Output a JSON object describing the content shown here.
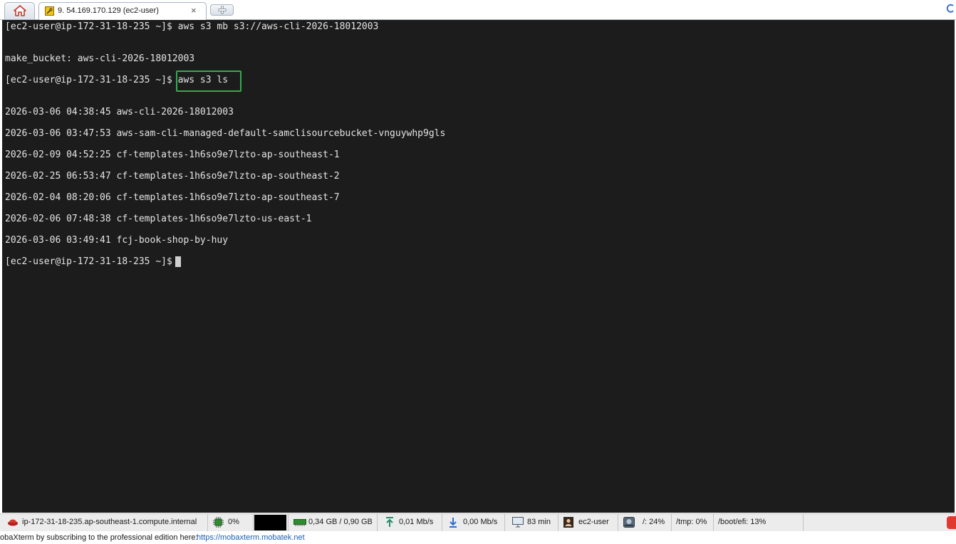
{
  "tabs": {
    "home_icon": "home-icon",
    "session_tab": {
      "label": "9. 54.169.170.129 (ec2-user)",
      "close": "×",
      "icon": "wrench-icon"
    },
    "new_tab_icon": "plus-icon"
  },
  "terminal": {
    "lines": [
      "[ec2-user@ip-172-31-18-235 ~]$ aws s3 mb s3://aws-cli-2026-18012003",
      "make_bucket: aws-cli-2026-18012003",
      "[ec2-user@ip-172-31-18-235 ~]$ aws s3 ls",
      "2026-03-06 04:38:45 aws-cli-2026-18012003",
      "2026-03-06 03:47:53 aws-sam-cli-managed-default-samclisourcebucket-vnguywhp9gls",
      "2026-02-09 04:52:25 cf-templates-1h6so9e7lzto-ap-southeast-1",
      "2026-02-25 06:53:47 cf-templates-1h6so9e7lzto-ap-southeast-2",
      "2026-02-04 08:20:06 cf-templates-1h6so9e7lzto-ap-southeast-7",
      "2026-02-06 07:48:38 cf-templates-1h6so9e7lzto-us-east-1",
      "2026-03-06 03:49:41 fcj-book-shop-by-huy",
      "[ec2-user@ip-172-31-18-235 ~]$"
    ],
    "highlighted_command": "aws s3 ls",
    "highlight_color": "#2fae4a",
    "background_color": "#1c1c1c",
    "text_color": "#e4e4e4"
  },
  "statusbar": {
    "host": "ip-172-31-18-235.ap-southeast-1.compute.internal",
    "cpu": "0%",
    "memory": "0,34 GB / 0,90 GB",
    "upload": "0,01 Mb/s",
    "download": "0,00 Mb/s",
    "uptime": "83 min",
    "user": "ec2-user",
    "disk_root": "/: 24%",
    "disk_tmp": "/tmp: 0%",
    "disk_boot": "/boot/efi: 13%"
  },
  "footer": {
    "message": "obaXterm by subscribing to the professional edition here:",
    "link": "https://mobaxterm.mobatek.net"
  }
}
